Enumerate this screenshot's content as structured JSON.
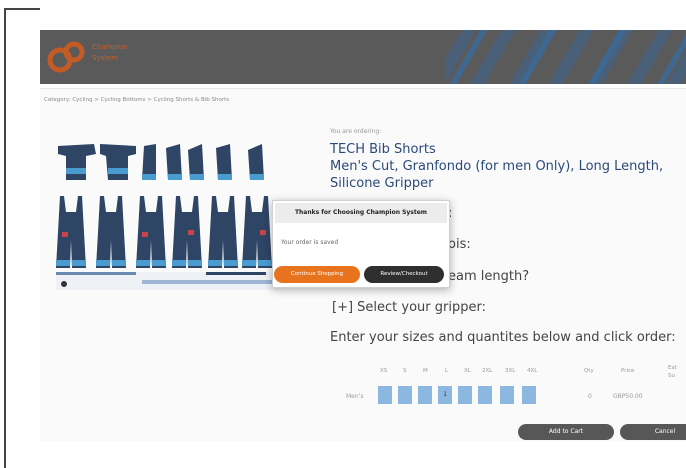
{
  "brand": {
    "logo_text": "Champion\nSystem"
  },
  "breadcrumb": "Category: Cycling > Cycling Bottoms > Cycling Shorts & Bib Shorts",
  "order": {
    "intro": "You are ordering:",
    "product_name": "TECH Bib Shorts",
    "variant": "Men's Cut, Granfondo (for men Only), Long Length, Silicone Gripper"
  },
  "questions": {
    "q1_tail": ":",
    "q2_tail": "ois:",
    "q3_tail": "eam length?",
    "gripper": "[+] Select your gripper:",
    "instructions": "Enter your sizes and quantites below and click order:"
  },
  "sizes": {
    "headers": [
      "XS",
      "S",
      "M",
      "L",
      "XL",
      "2XL",
      "3XL",
      "4XL"
    ],
    "row_label": "Men's",
    "values": [
      "",
      "",
      "",
      "1",
      "",
      "",
      "",
      ""
    ],
    "qty_header": "Qty",
    "price_header": "Price",
    "ext_header": "Ext Su",
    "qty_value": "0",
    "price_value": "GBP50.00"
  },
  "modal": {
    "title": "Thanks for Choosing Champion System",
    "message": "Your order is saved",
    "continue_label": "Continue Shopping",
    "review_label": "Review/Checkout"
  },
  "actions": {
    "add_to_cart": "Add to Cart",
    "cancel": "Cancel"
  },
  "colors": {
    "accent": "#e8731e",
    "title_blue": "#2b4a7a",
    "size_box": "#8bb7e0",
    "header_bg": "#5a5a5a"
  }
}
